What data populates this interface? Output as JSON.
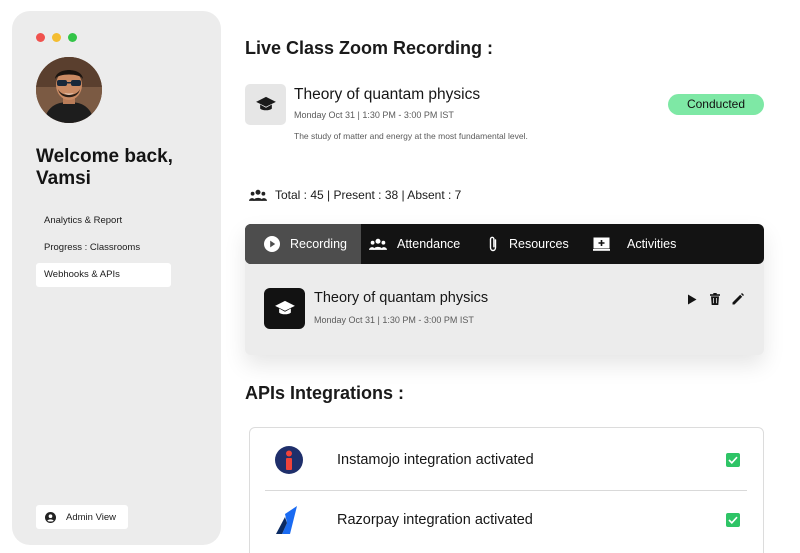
{
  "window": {
    "dot_colors": [
      "#f0524e",
      "#f4bd31",
      "#33c448"
    ]
  },
  "sidebar": {
    "welcome": "Welcome back, Vamsi",
    "items": [
      {
        "label": "Analytics & Report"
      },
      {
        "label": "Progress : Classrooms"
      },
      {
        "label": "Webhooks & APIs",
        "active": true
      }
    ],
    "admin_label": "Admin View"
  },
  "main": {
    "heading": "Live Class Zoom Recording :",
    "class": {
      "title": "Theory of quantam physics",
      "date": "Monday Oct 31 | 1:30 PM - 3:00 PM IST",
      "description": "The study of matter and energy at the most fundamental level.",
      "status": "Conducted",
      "status_color": "#7ee8a5"
    },
    "stats": "Total : 45 | Present : 38 | Absent : 7",
    "tabs": [
      {
        "label": "Recording",
        "icon": "play-circle-icon",
        "active": true
      },
      {
        "label": "Attendance",
        "icon": "group-icon"
      },
      {
        "label": "Resources",
        "icon": "paperclip-icon"
      },
      {
        "label": "Activities",
        "icon": "screen-icon"
      }
    ],
    "recording": {
      "title": "Theory of quantam physics",
      "date": "Monday Oct 31 | 1:30 PM - 3:00 PM IST",
      "actions": [
        "play-icon",
        "trash-icon",
        "pencil-icon"
      ]
    },
    "apis_heading": "APIs Integrations :",
    "apis": [
      {
        "label": "Instamojo integration activated",
        "icon": "instamojo-logo",
        "checked": true
      },
      {
        "label": "Razorpay integration activated",
        "icon": "razorpay-logo",
        "checked": true
      }
    ]
  }
}
